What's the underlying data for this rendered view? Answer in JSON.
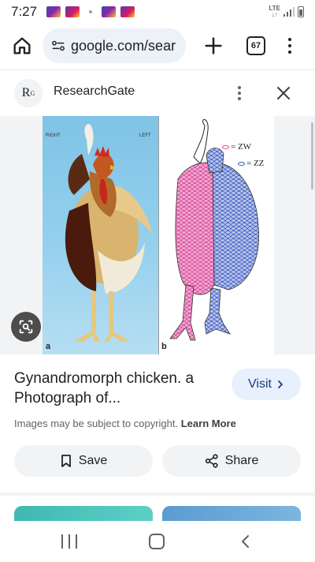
{
  "status_bar": {
    "time": "7:27",
    "network": "LTE",
    "network_sub": "↓↑"
  },
  "browser": {
    "url": "google.com/sear",
    "tab_count": "67"
  },
  "source": {
    "logo_text": "R",
    "logo_sup": "G",
    "name": "ResearchGate"
  },
  "figure": {
    "label_right": "RIGHT",
    "label_left": "LEFT",
    "panel_a_letter": "a",
    "panel_b_letter": "b",
    "legend": [
      {
        "label": "= ZW",
        "color": "#e0489a"
      },
      {
        "label": "= ZZ",
        "color": "#3b5bc4"
      }
    ]
  },
  "result": {
    "title": "Gynandromorph chicken. a Photograph of...",
    "visit_label": "Visit",
    "copyright_text": "Images may be subject to copyright.",
    "learn_more": "Learn More",
    "save_label": "Save",
    "share_label": "Share"
  },
  "colors": {
    "accent_pill": "#e8f0fe",
    "button_bg": "#f1f3f4",
    "zw_pink": "#e0489a",
    "zz_blue": "#3b5bc4"
  }
}
